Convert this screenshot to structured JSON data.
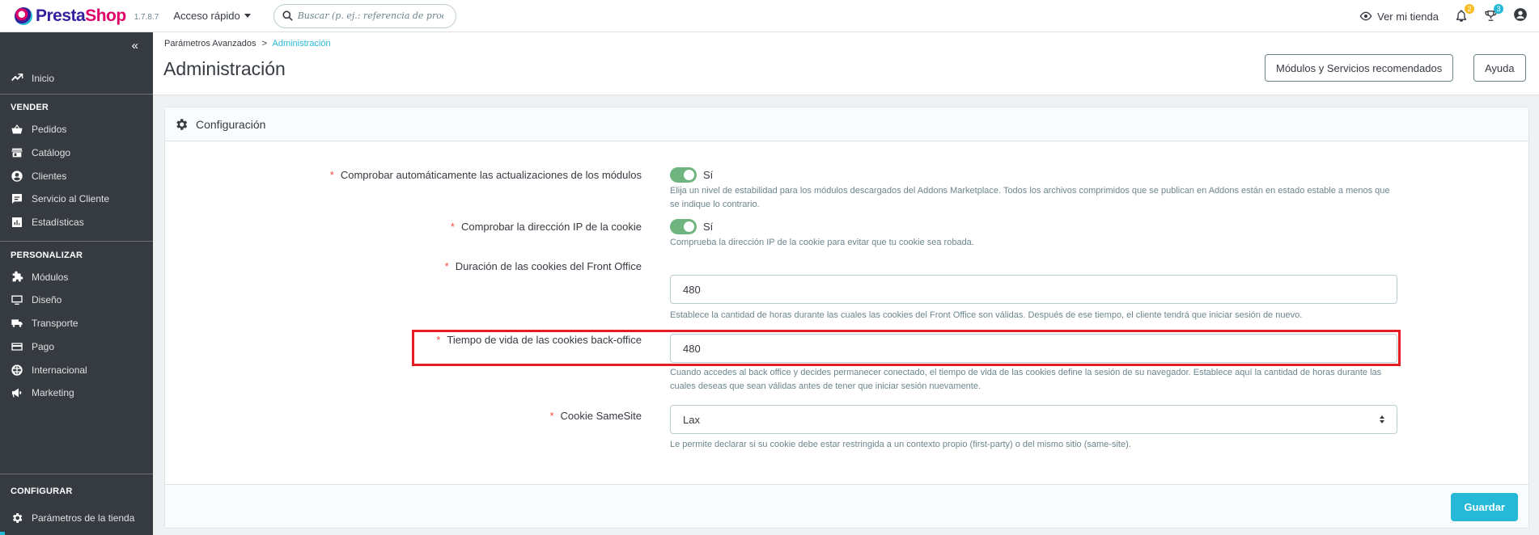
{
  "header": {
    "logo_text_a": "Presta",
    "logo_text_b": "Shop",
    "version": "1.7.8.7",
    "quick_access": "Acceso rápido",
    "search_placeholder": "Buscar (p. ej.: referencia de producto,",
    "view_store": "Ver mi tienda",
    "notifications_count": "2",
    "trophy_count": "3"
  },
  "sidebar": {
    "collapse_glyph": "«",
    "home": "Inicio",
    "sections": [
      {
        "title": "VENDER",
        "items": [
          "Pedidos",
          "Catálogo",
          "Clientes",
          "Servicio al Cliente",
          "Estadísticas"
        ]
      },
      {
        "title": "PERSONALIZAR",
        "items": [
          "Módulos",
          "Diseño",
          "Transporte",
          "Pago",
          "Internacional",
          "Marketing"
        ]
      },
      {
        "title": "CONFIGURAR",
        "items": [
          "Parámetros de la tienda"
        ]
      }
    ]
  },
  "toolbar": {
    "breadcrumb_parent": "Parámetros Avanzados",
    "breadcrumb_sep": ">",
    "breadcrumb_current": "Administración",
    "title": "Administración",
    "recommended_button": "Módulos y Servicios recomendados",
    "help_button": "Ayuda"
  },
  "card": {
    "title": "Configuración",
    "save_button": "Guardar",
    "fields": [
      {
        "label": "Comprobar automáticamente las actualizaciones de los módulos",
        "type": "toggle",
        "value": "Sí",
        "help": "Elija un nivel de estabilidad para los módulos descargados del Addons Marketplace. Todos los archivos comprimidos que se publican en Addons están en estado estable a menos que se indique lo contrario."
      },
      {
        "label": "Comprobar la dirección IP de la cookie",
        "type": "toggle",
        "value": "Sí",
        "help": "Comprueba la dirección IP de la cookie para evitar que tu cookie sea robada."
      },
      {
        "label": "Duración de las cookies del Front Office",
        "type": "text",
        "value": "480",
        "help": "Establece la cantidad de horas durante las cuales las cookies del Front Office son válidas. Después de ese tiempo, el cliente tendrá que iniciar sesión de nuevo."
      },
      {
        "label": "Tiempo de vida de las cookies back-office",
        "type": "text",
        "value": "480",
        "help": "Cuando accedes al back office y decides permanecer conectado, el tiempo de vida de las cookies define la sesión de su navegador. Establece aquí la cantidad de horas durante las cuales deseas que sean válidas antes de tener que iniciar sesión nuevamente."
      },
      {
        "label": "Cookie SameSite",
        "type": "select",
        "value": "Lax",
        "help": "Le permite declarar si su cookie debe estar restringida a un contexto propio (first-party) o del mismo sitio (same-site)."
      }
    ]
  },
  "colors": {
    "accent": "#25b9d7",
    "sidebar_bg": "#363a41",
    "toggle_on": "#70b580",
    "required": "#f54c3e",
    "highlight": "#e51c23"
  }
}
